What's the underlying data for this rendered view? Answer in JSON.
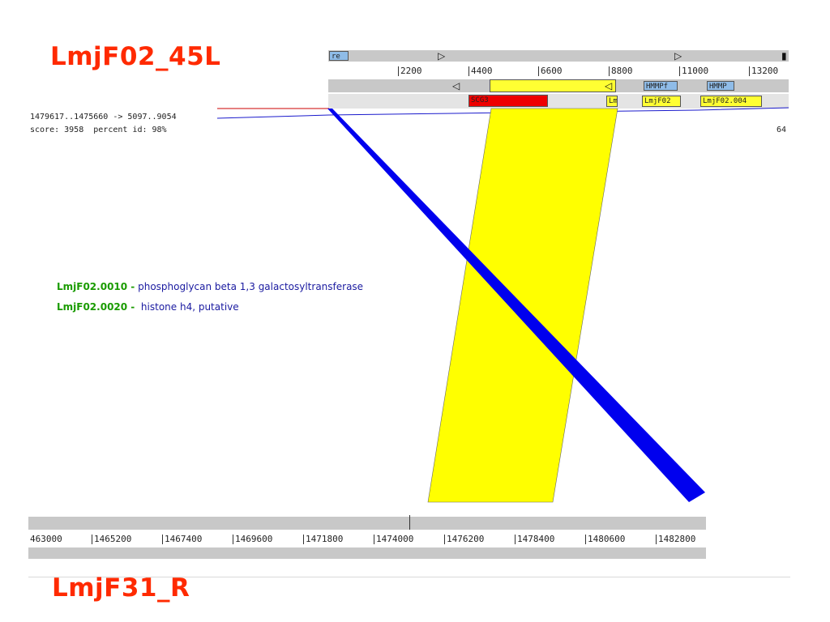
{
  "titles": {
    "top": "LmjF02_45L",
    "bottom": "LmjF31_R"
  },
  "alignment_info": {
    "coords": "1479617..1475660 -> 5097..9054",
    "score": "score: 3958  percent id: 98%",
    "right_label": "64"
  },
  "top_ruler": {
    "ticks": [
      "2200",
      "4400",
      "6600",
      "8800",
      "11000",
      "13200"
    ]
  },
  "bottom_ruler": {
    "ticks": [
      "463000",
      "1465200",
      "1467400",
      "1469600",
      "1471800",
      "1474000",
      "1476200",
      "1478400",
      "1480600",
      "1482800"
    ]
  },
  "top_features": {
    "row1": [
      {
        "label": "re",
        "color": "#8fbce8"
      }
    ],
    "row2": [
      {
        "label": "HMMPf",
        "color": "#8fbce8"
      },
      {
        "label": "HMMP",
        "color": "#8fbce8"
      }
    ],
    "row3": [
      {
        "label": "SCG3",
        "color": "#ee0000"
      },
      {
        "label": "Lm",
        "color": "#ffff33"
      },
      {
        "label": "LmjF02",
        "color": "#ffff33"
      },
      {
        "label": "LmjF02.004",
        "color": "#ffff33"
      }
    ]
  },
  "genes": [
    {
      "id": "LmjF02.0010",
      "sep": " -",
      "desc": " phosphoglycan beta 1,3 galactosyltransferase"
    },
    {
      "id": "LmjF02.0020",
      "sep": " -",
      "desc": "  histone h4, putative"
    }
  ],
  "colors": {
    "title": "#ff2a00",
    "gene_id": "#1a9b00",
    "gene_desc": "#1a1aa0",
    "match_fill": "#ffff00",
    "blast_line": "#0000ee",
    "sequence_line_top": "#cc0000"
  }
}
